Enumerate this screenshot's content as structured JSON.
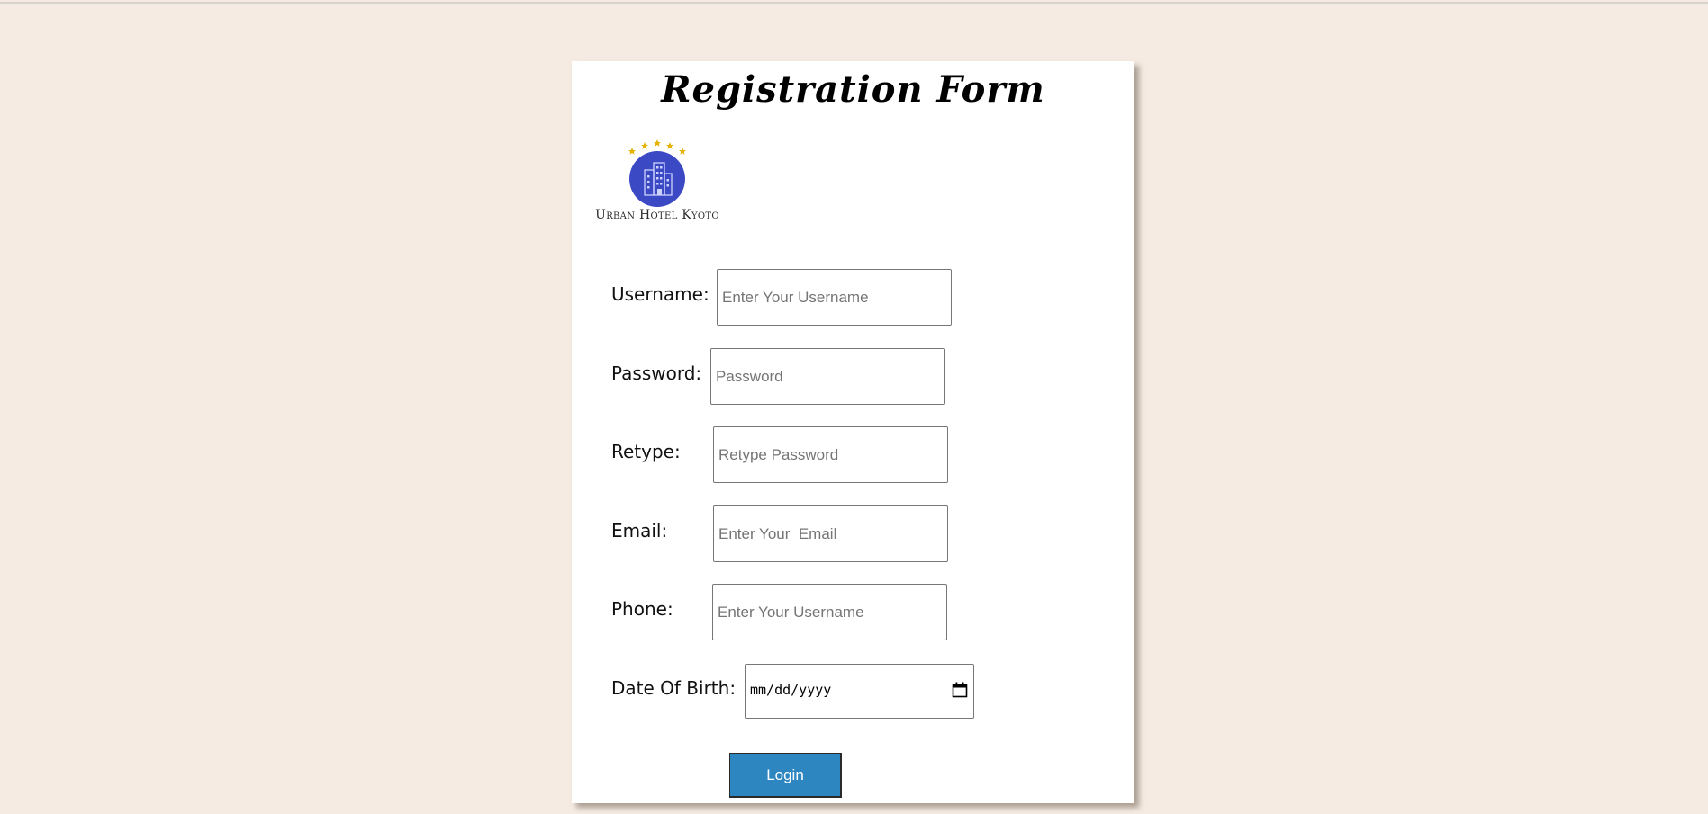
{
  "form": {
    "title": "Registration Form",
    "logo_text": "Urban Hotel Kyoto",
    "fields": {
      "username": {
        "label": "Username:",
        "placeholder": "Enter Your Username"
      },
      "password": {
        "label": "Password:",
        "placeholder": "Password"
      },
      "retype": {
        "label": "Retype:",
        "placeholder": "Retype Password"
      },
      "email": {
        "label": "Email:",
        "placeholder": "Enter Your  Email"
      },
      "phone": {
        "label": "Phone:",
        "placeholder": "Enter Your Username"
      },
      "dob": {
        "label": "Date Of Birth:",
        "placeholder": "mm/dd/yyyy"
      }
    },
    "submit_label": "Login"
  },
  "colors": {
    "page_background": "#f5ebe2",
    "button_background": "#2e86c1",
    "logo_circle": "#3b49c4",
    "logo_stars": "#e8b000"
  },
  "icons": {
    "logo": "hotel-building-icon",
    "calendar": "calendar-icon"
  }
}
